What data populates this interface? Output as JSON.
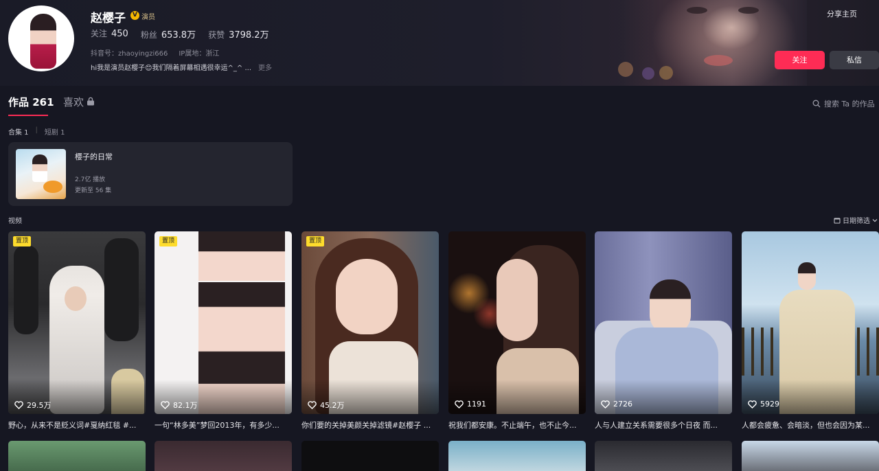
{
  "profile": {
    "name": "赵樱子",
    "verified_icon": "V",
    "role": "演员",
    "stats": [
      {
        "label": "关注",
        "value": "450"
      },
      {
        "label": "粉丝",
        "value": "653.8万"
      },
      {
        "label": "获赞",
        "value": "3798.2万"
      }
    ],
    "douyin_id": "抖音号：zhaoyingzi666",
    "ip_location": "IP属地：浙江",
    "bio": "hi我是演员赵樱子😊我们隔着屏幕相遇很幸运^_^ ...",
    "bio_more": "更多"
  },
  "header": {
    "share_label": "分享主页",
    "follow_label": "关注",
    "message_label": "私信"
  },
  "tabs": {
    "works_label": "作品 261",
    "likes_label": "喜欢",
    "search_label": "搜索 Ta 的作品"
  },
  "subtabs": {
    "collections": "合集 1",
    "dramas": "短剧 1"
  },
  "collection": {
    "title": "樱子的日常",
    "plays": "2.7亿 播放",
    "update": "更新至 56 集"
  },
  "videos_label": "视频",
  "date_filter_label": "日期筛选",
  "videos": [
    {
      "pinned": true,
      "pin_label": "置顶",
      "likes": "29.5万",
      "caption": "野心，从来不是贬义词#戛纳红毯 #..."
    },
    {
      "pinned": true,
      "pin_label": "置顶",
      "likes": "82.1万",
      "caption": "一句“林多美”梦回2013年，有多少..."
    },
    {
      "pinned": true,
      "pin_label": "置顶",
      "likes": "45.2万",
      "caption": "你们要的关掉美颜关掉滤镜#赵樱子 ..."
    },
    {
      "pinned": false,
      "pin_label": "",
      "likes": "1191",
      "caption": "祝我们都安康。不止端午，也不止今..."
    },
    {
      "pinned": false,
      "pin_label": "",
      "likes": "2726",
      "caption": "人与人建立关系需要很多个日夜 而..."
    },
    {
      "pinned": false,
      "pin_label": "",
      "likes": "5929",
      "caption": "人都会疲惫、会暗淡，但也会因为某..."
    }
  ],
  "colors": {
    "accent": "#fe2c55",
    "pin_badge": "#fedc2c",
    "background": "#161722"
  }
}
